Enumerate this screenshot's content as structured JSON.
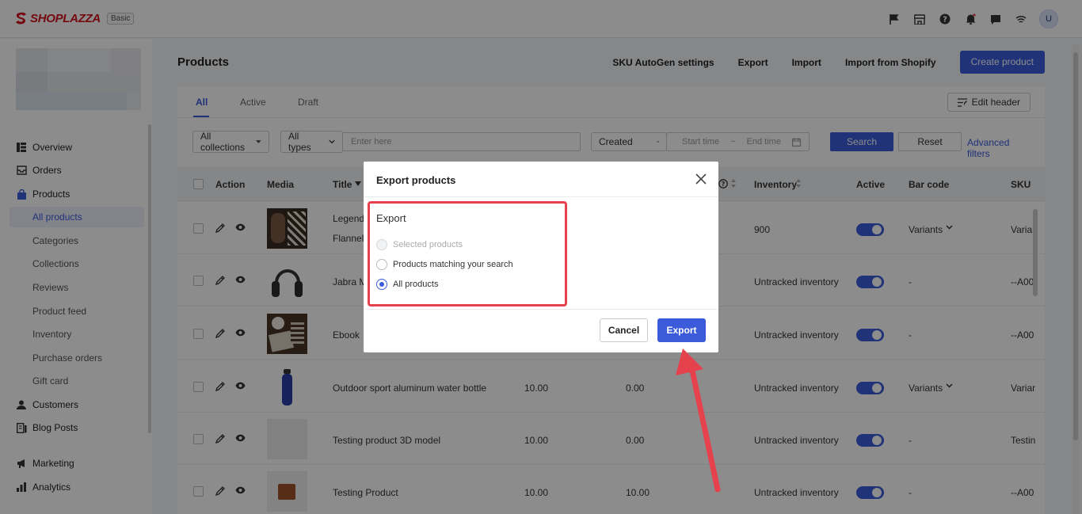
{
  "topbar": {
    "brand": "SHOPLAZZA",
    "plan": "Basic",
    "avatar_initial": "U",
    "icons": [
      "flag-icon",
      "store-icon",
      "help-icon",
      "bell-icon",
      "chat-icon",
      "wifi-icon"
    ]
  },
  "sidebar": {
    "items": [
      {
        "label": "Overview",
        "icon": "overview-icon"
      },
      {
        "label": "Orders",
        "icon": "orders-icon"
      },
      {
        "label": "Products",
        "icon": "products-icon"
      },
      {
        "label": "Customers",
        "icon": "customers-icon"
      },
      {
        "label": "Blog Posts",
        "icon": "blog-icon"
      },
      {
        "label": "Marketing",
        "icon": "marketing-icon"
      },
      {
        "label": "Analytics",
        "icon": "analytics-icon"
      }
    ],
    "product_sub": [
      "All products",
      "Categories",
      "Collections",
      "Reviews",
      "Product feed",
      "Inventory",
      "Purchase orders",
      "Gift card"
    ]
  },
  "page": {
    "title": "Products",
    "actions": [
      "SKU AutoGen settings",
      "Export",
      "Import",
      "Import from Shopify"
    ],
    "create_label": "Create product"
  },
  "tabs": [
    "All",
    "Active",
    "Draft"
  ],
  "edit_header_label": "Edit header",
  "filters": {
    "collections": "All collections",
    "types": "All types",
    "search_placeholder": "Enter here",
    "sort": "Created",
    "start_placeholder": "Start time",
    "tilde": "~",
    "end_placeholder": "End time",
    "search_label": "Search",
    "reset_label": "Reset",
    "advanced_label": "Advanced filters"
  },
  "table": {
    "headers": {
      "action": "Action",
      "media": "Media",
      "title": "Title",
      "inventory": "Inventory",
      "active": "Active",
      "barcode": "Bar code",
      "sku": "SKU"
    },
    "rows": [
      {
        "title": "Legenda",
        "title2": "Flannel",
        "price": "",
        "compare": "",
        "inventory": "900",
        "barcode": "Variants",
        "sku": "Variar"
      },
      {
        "title": "Jabra M",
        "title2": "",
        "price": "",
        "compare": "",
        "inventory": "Untracked inventory",
        "barcode": "-",
        "sku": "--A00"
      },
      {
        "title": "Ebook",
        "title2": "",
        "price": "",
        "compare": "",
        "inventory": "Untracked inventory",
        "barcode": "-",
        "sku": "--A00"
      },
      {
        "title": "Outdoor sport aluminum water bottle",
        "title2": "",
        "price": "10.00",
        "compare": "0.00",
        "inventory": "Untracked inventory",
        "barcode": "Variants",
        "sku": "Variar"
      },
      {
        "title": "Testing product 3D model",
        "title2": "",
        "price": "10.00",
        "compare": "0.00",
        "inventory": "Untracked inventory",
        "barcode": "-",
        "sku": "Testin"
      },
      {
        "title": "Testing Product",
        "title2": "",
        "price": "10.00",
        "compare": "10.00",
        "inventory": "Untracked inventory",
        "barcode": "-",
        "sku": "--A00"
      }
    ]
  },
  "modal": {
    "title": "Export products",
    "section": "Export",
    "options": [
      {
        "label": "Selected products",
        "state": "disabled"
      },
      {
        "label": "Products matching your search",
        "state": "unchecked"
      },
      {
        "label": "All products",
        "state": "checked"
      }
    ],
    "cancel_label": "Cancel",
    "export_label": "Export"
  },
  "colors": {
    "primary": "#3b5bdb",
    "brand_red": "#d4121e",
    "annotation_red": "#e5424d"
  }
}
